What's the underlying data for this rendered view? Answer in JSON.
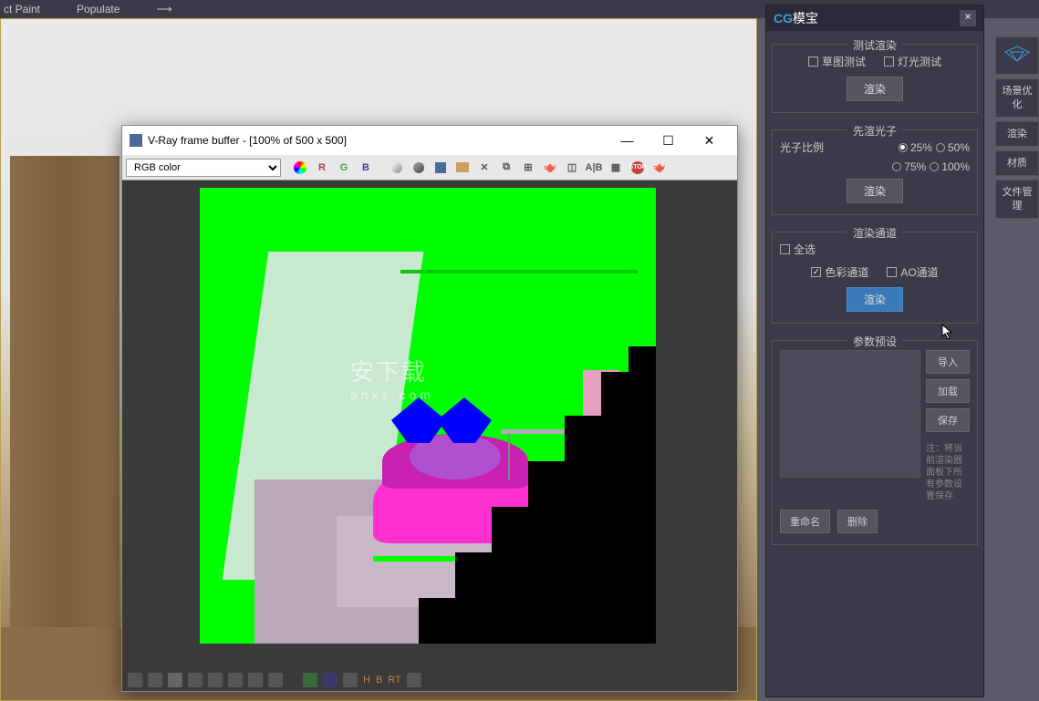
{
  "topMenu": {
    "item1": "ct Paint",
    "item2": "Populate",
    "item3": "⟶"
  },
  "vray": {
    "title": "V-Ray frame buffer - [100% of 500 x 500]",
    "channelSelect": "RGB color",
    "toolbar": {
      "r": "R",
      "g": "G",
      "b": "B",
      "h": "H",
      "b2": "B",
      "rt": "RT"
    },
    "watermark": "安下载",
    "watermarkSub": "anxz.com"
  },
  "panel": {
    "logo": "CG",
    "logoCn": "模宝",
    "sections": {
      "testRender": {
        "legend": "测试渲染",
        "sketch": "草图测试",
        "light": "灯光测试",
        "btn": "渲染"
      },
      "prePhoton": {
        "legend": "先渲光子",
        "ratioLabel": "光子比例",
        "opt25": "25%",
        "opt50": "50%",
        "opt75": "75%",
        "opt100": "100%",
        "btn": "渲染"
      },
      "renderElements": {
        "legend": "渲染通道",
        "selectAll": "全选",
        "colorChannel": "色彩通道",
        "aoChannel": "AO通道",
        "btn": "渲染"
      },
      "presets": {
        "legend": "参数预设",
        "import": "导入",
        "load": "加载",
        "save": "保存",
        "note": "注：将当前渲染器面板下所有参数设置保存",
        "rename": "重命名",
        "delete": "删除"
      }
    }
  },
  "sideTabs": {
    "sceneOpt": "场景优化",
    "render": "渲染",
    "material": "材质",
    "fileMgr": "文件管理"
  }
}
